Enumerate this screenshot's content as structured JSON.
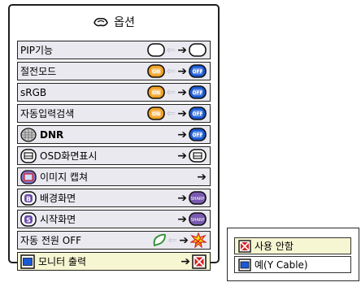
{
  "title": "옵션",
  "rows": [
    {
      "label": "PIP기능",
      "lead": null,
      "bold": false,
      "left_state": "blank",
      "right_state": "blank",
      "arrow_left": true
    },
    {
      "label": "절전모드",
      "lead": null,
      "bold": false,
      "left_state": "on",
      "right_state": "off",
      "arrow_left": true
    },
    {
      "label": "sRGB",
      "lead": null,
      "bold": false,
      "left_state": "on",
      "right_state": "off",
      "arrow_left": true
    },
    {
      "label": "자동입력검색",
      "lead": null,
      "bold": false,
      "left_state": "on",
      "right_state": "off",
      "arrow_left": true
    },
    {
      "label": "DNR",
      "lead": "dnr-icon",
      "bold": true,
      "left_state": null,
      "right_state": "off",
      "arrow_left": false
    },
    {
      "label": "OSD화면표시",
      "lead": "osd-icon",
      "bold": false,
      "left_state": null,
      "right_state": "osd",
      "arrow_left": false
    },
    {
      "label": "이미지 캡쳐",
      "lead": "capture-icon",
      "bold": false,
      "left_state": null,
      "right_state": null,
      "arrow_left": false
    },
    {
      "label": "배경화면",
      "lead": "background-icon",
      "bold": false,
      "left_state": null,
      "right_state": "sharp",
      "arrow_left": false
    },
    {
      "label": "시작화면",
      "lead": "startup-icon",
      "bold": false,
      "left_state": null,
      "right_state": "sharp",
      "arrow_left": false
    },
    {
      "label": "자동 전원 OFF",
      "lead": null,
      "bold": false,
      "left_state": "leaf",
      "right_state": "burst",
      "arrow_left": true
    },
    {
      "label": "모니터 출력",
      "lead": "monitor-icon",
      "bold": false,
      "left_state": null,
      "right_state": "monitor-x",
      "arrow_left": false
    }
  ],
  "sharp_text": "SHARP",
  "on_text": "ON",
  "off_text": "OFF",
  "submenu": [
    {
      "label": "사용 안함",
      "icon": "monitor-x-icon"
    },
    {
      "label": "예(Y Cable)",
      "icon": "monitor-icon"
    }
  ],
  "colors": {
    "orange": "#f0a020",
    "blue": "#1a5ad6",
    "green": "#2e8b2e",
    "red": "#d42020",
    "row_bg": "#e9e9ef",
    "selected_bg": "#f6f6d2"
  }
}
